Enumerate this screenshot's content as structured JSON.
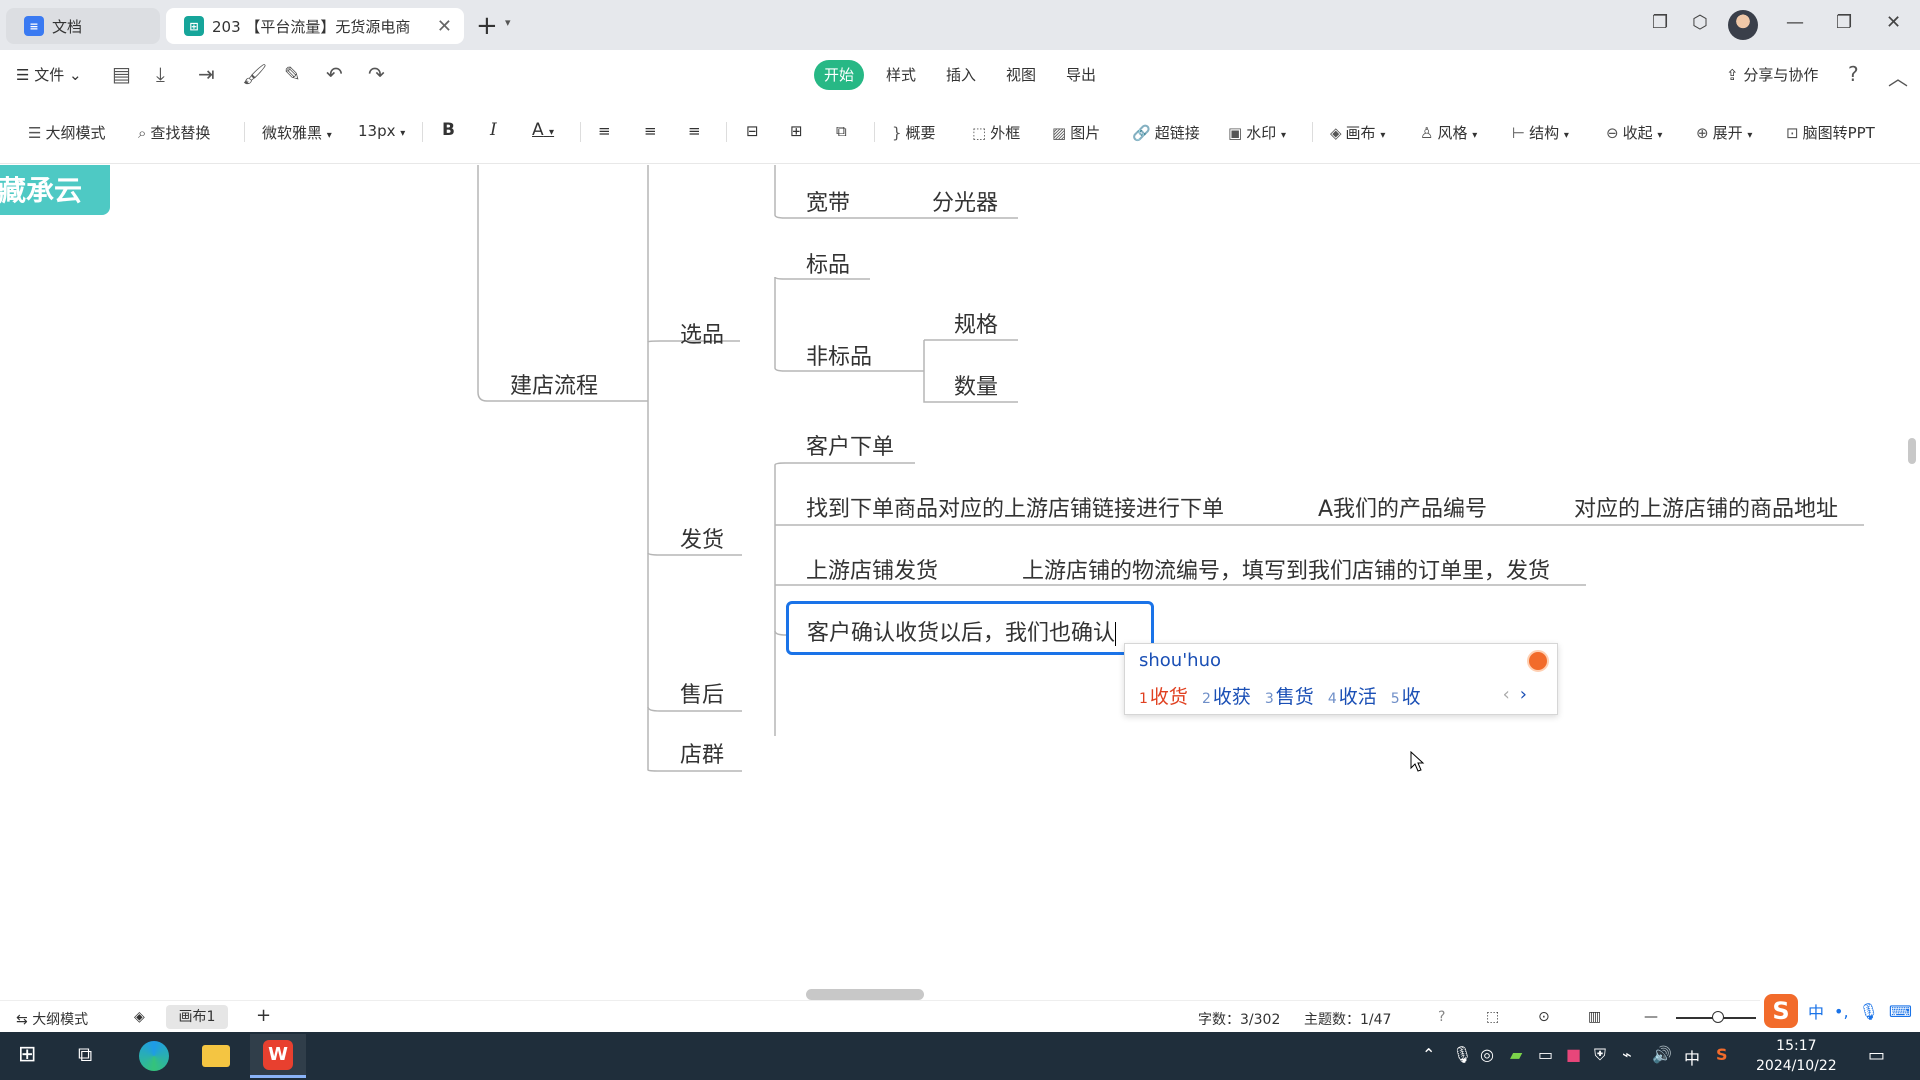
{
  "tabs": [
    {
      "label": "文档",
      "icon": "docs-icon"
    },
    {
      "label": "203 【平台流量】无货源电商",
      "icon": "mindmap-icon"
    }
  ],
  "menubar": {
    "file": "文件",
    "tabs": [
      "开始",
      "样式",
      "插入",
      "视图",
      "导出"
    ],
    "active_tab": "开始",
    "share": "分享与协作"
  },
  "toolbar": {
    "outline_mode": "大纲模式",
    "find_replace": "查找替换",
    "font": "微软雅黑",
    "font_size": "13px",
    "bold": "B",
    "italic": "I",
    "font_color": "A",
    "summary": "概要",
    "frame": "外框",
    "image": "图片",
    "hyperlink": "超链接",
    "watermark": "水印",
    "canvas": "画布",
    "style": "风格",
    "structure": "结构",
    "collapse": "收起",
    "expand": "展开",
    "to_ppt": "脑图转PPT"
  },
  "mindmap": {
    "cut_off_root": "藏承云",
    "nodes": {
      "jiandian": "建店流程",
      "xuanpin": "选品",
      "kuandai": "宽带",
      "fenguangqi": "分光器",
      "biaopin": "标品",
      "feibiaopin": "非标品",
      "guige": "规格",
      "shuliang": "数量",
      "fahuo": "发货",
      "kehu_xiadan": "客户下单",
      "zhaodao": "找到下单商品对应的上游店铺链接进行下单",
      "bianhao": "A我们的产品编号",
      "dizhi": "对应的上游店铺的商品地址",
      "shangyou_fahuo": "上游店铺发货",
      "wuliu": "上游店铺的物流编号，填写到我们店铺的订单里，发货",
      "shouhou": "售后",
      "dianqun": "店群"
    },
    "editing_text": "客户确认收货以后，我们也确认"
  },
  "ime": {
    "composition": "shou'huo",
    "candidates": [
      {
        "n": "1",
        "text": "收货"
      },
      {
        "n": "2",
        "text": "收获"
      },
      {
        "n": "3",
        "text": "售货"
      },
      {
        "n": "4",
        "text": "收活"
      },
      {
        "n": "5",
        "text": "收"
      }
    ],
    "selected": 0
  },
  "statusbar": {
    "outline_mode": "大纲模式",
    "canvas_tab": "画布1",
    "word_count": "字数：3/302",
    "topic_count": "主题数：1/47"
  },
  "taskbar": {
    "time": "15:17",
    "date": "2024/10/22",
    "ime_lang": "中"
  },
  "colors": {
    "accent": "#27b885",
    "edit_border": "#1a73e8",
    "root_node": "#4ec9c4",
    "connector": "#b5b5b5"
  }
}
